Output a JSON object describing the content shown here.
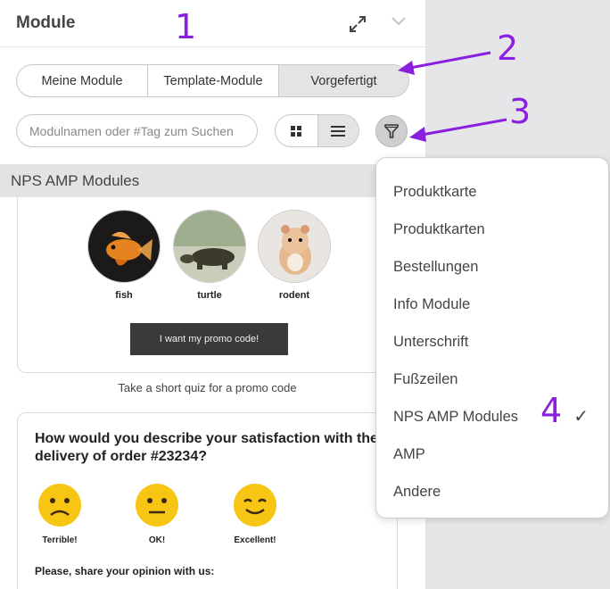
{
  "header": {
    "title": "Module"
  },
  "tabs": [
    "Meine Module",
    "Template-Module",
    "Vorgefertigt"
  ],
  "search": {
    "placeholder": "Modulnamen oder #Tag zum Suchen"
  },
  "section": {
    "title": "NPS AMP Modules"
  },
  "quiz_card": {
    "animals": [
      "fish",
      "turtle",
      "rodent"
    ],
    "button_label": "I want my promo code!",
    "caption": "Take a short quiz for a promo code"
  },
  "nps_card": {
    "question": "How would you describe your satisfaction with the delivery of order #23234?",
    "faces": [
      "Terrible!",
      "OK!",
      "Excellent!"
    ],
    "share_label": "Please, share your opinion with us:"
  },
  "dropdown": {
    "items": [
      "Produktkarte",
      "Produktkarten",
      "Bestellungen",
      "Info Module",
      "Unterschrift",
      "Fußzeilen",
      "NPS AMP Modules",
      "AMP",
      "Andere"
    ],
    "selected": "NPS AMP Modules",
    "check_mark": "✓"
  },
  "annotations": [
    "1",
    "2",
    "3",
    "4"
  ],
  "colors": {
    "annotation": "#8a1fe0",
    "face_yellow": "#f7c614",
    "promo_button": "#3a3a3a"
  }
}
